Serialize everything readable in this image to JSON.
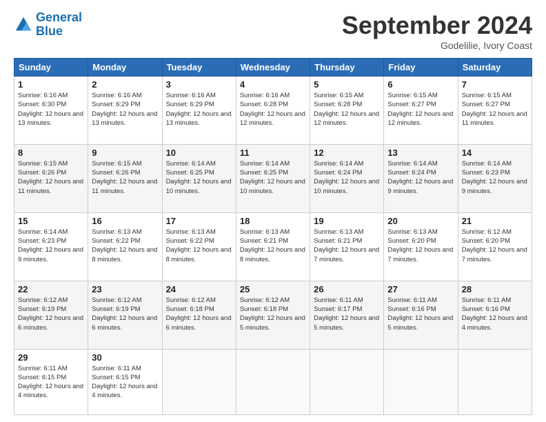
{
  "header": {
    "logo_text_general": "General",
    "logo_text_blue": "Blue",
    "month_title": "September 2024",
    "location": "Godelilie, Ivory Coast"
  },
  "days_of_week": [
    "Sunday",
    "Monday",
    "Tuesday",
    "Wednesday",
    "Thursday",
    "Friday",
    "Saturday"
  ],
  "weeks": [
    [
      {
        "day": "1",
        "sunrise": "Sunrise: 6:16 AM",
        "sunset": "Sunset: 6:30 PM",
        "daylight": "Daylight: 12 hours and 13 minutes."
      },
      {
        "day": "2",
        "sunrise": "Sunrise: 6:16 AM",
        "sunset": "Sunset: 6:29 PM",
        "daylight": "Daylight: 12 hours and 13 minutes."
      },
      {
        "day": "3",
        "sunrise": "Sunrise: 6:16 AM",
        "sunset": "Sunset: 6:29 PM",
        "daylight": "Daylight: 12 hours and 13 minutes."
      },
      {
        "day": "4",
        "sunrise": "Sunrise: 6:16 AM",
        "sunset": "Sunset: 6:28 PM",
        "daylight": "Daylight: 12 hours and 12 minutes."
      },
      {
        "day": "5",
        "sunrise": "Sunrise: 6:15 AM",
        "sunset": "Sunset: 6:28 PM",
        "daylight": "Daylight: 12 hours and 12 minutes."
      },
      {
        "day": "6",
        "sunrise": "Sunrise: 6:15 AM",
        "sunset": "Sunset: 6:27 PM",
        "daylight": "Daylight: 12 hours and 12 minutes."
      },
      {
        "day": "7",
        "sunrise": "Sunrise: 6:15 AM",
        "sunset": "Sunset: 6:27 PM",
        "daylight": "Daylight: 12 hours and 11 minutes."
      }
    ],
    [
      {
        "day": "8",
        "sunrise": "Sunrise: 6:15 AM",
        "sunset": "Sunset: 6:26 PM",
        "daylight": "Daylight: 12 hours and 11 minutes."
      },
      {
        "day": "9",
        "sunrise": "Sunrise: 6:15 AM",
        "sunset": "Sunset: 6:26 PM",
        "daylight": "Daylight: 12 hours and 11 minutes."
      },
      {
        "day": "10",
        "sunrise": "Sunrise: 6:14 AM",
        "sunset": "Sunset: 6:25 PM",
        "daylight": "Daylight: 12 hours and 10 minutes."
      },
      {
        "day": "11",
        "sunrise": "Sunrise: 6:14 AM",
        "sunset": "Sunset: 6:25 PM",
        "daylight": "Daylight: 12 hours and 10 minutes."
      },
      {
        "day": "12",
        "sunrise": "Sunrise: 6:14 AM",
        "sunset": "Sunset: 6:24 PM",
        "daylight": "Daylight: 12 hours and 10 minutes."
      },
      {
        "day": "13",
        "sunrise": "Sunrise: 6:14 AM",
        "sunset": "Sunset: 6:24 PM",
        "daylight": "Daylight: 12 hours and 9 minutes."
      },
      {
        "day": "14",
        "sunrise": "Sunrise: 6:14 AM",
        "sunset": "Sunset: 6:23 PM",
        "daylight": "Daylight: 12 hours and 9 minutes."
      }
    ],
    [
      {
        "day": "15",
        "sunrise": "Sunrise: 6:14 AM",
        "sunset": "Sunset: 6:23 PM",
        "daylight": "Daylight: 12 hours and 9 minutes."
      },
      {
        "day": "16",
        "sunrise": "Sunrise: 6:13 AM",
        "sunset": "Sunset: 6:22 PM",
        "daylight": "Daylight: 12 hours and 8 minutes."
      },
      {
        "day": "17",
        "sunrise": "Sunrise: 6:13 AM",
        "sunset": "Sunset: 6:22 PM",
        "daylight": "Daylight: 12 hours and 8 minutes."
      },
      {
        "day": "18",
        "sunrise": "Sunrise: 6:13 AM",
        "sunset": "Sunset: 6:21 PM",
        "daylight": "Daylight: 12 hours and 8 minutes."
      },
      {
        "day": "19",
        "sunrise": "Sunrise: 6:13 AM",
        "sunset": "Sunset: 6:21 PM",
        "daylight": "Daylight: 12 hours and 7 minutes."
      },
      {
        "day": "20",
        "sunrise": "Sunrise: 6:13 AM",
        "sunset": "Sunset: 6:20 PM",
        "daylight": "Daylight: 12 hours and 7 minutes."
      },
      {
        "day": "21",
        "sunrise": "Sunrise: 6:12 AM",
        "sunset": "Sunset: 6:20 PM",
        "daylight": "Daylight: 12 hours and 7 minutes."
      }
    ],
    [
      {
        "day": "22",
        "sunrise": "Sunrise: 6:12 AM",
        "sunset": "Sunset: 6:19 PM",
        "daylight": "Daylight: 12 hours and 6 minutes."
      },
      {
        "day": "23",
        "sunrise": "Sunrise: 6:12 AM",
        "sunset": "Sunset: 6:19 PM",
        "daylight": "Daylight: 12 hours and 6 minutes."
      },
      {
        "day": "24",
        "sunrise": "Sunrise: 6:12 AM",
        "sunset": "Sunset: 6:18 PM",
        "daylight": "Daylight: 12 hours and 6 minutes."
      },
      {
        "day": "25",
        "sunrise": "Sunrise: 6:12 AM",
        "sunset": "Sunset: 6:18 PM",
        "daylight": "Daylight: 12 hours and 5 minutes."
      },
      {
        "day": "26",
        "sunrise": "Sunrise: 6:11 AM",
        "sunset": "Sunset: 6:17 PM",
        "daylight": "Daylight: 12 hours and 5 minutes."
      },
      {
        "day": "27",
        "sunrise": "Sunrise: 6:11 AM",
        "sunset": "Sunset: 6:16 PM",
        "daylight": "Daylight: 12 hours and 5 minutes."
      },
      {
        "day": "28",
        "sunrise": "Sunrise: 6:11 AM",
        "sunset": "Sunset: 6:16 PM",
        "daylight": "Daylight: 12 hours and 4 minutes."
      }
    ],
    [
      {
        "day": "29",
        "sunrise": "Sunrise: 6:11 AM",
        "sunset": "Sunset: 6:15 PM",
        "daylight": "Daylight: 12 hours and 4 minutes."
      },
      {
        "day": "30",
        "sunrise": "Sunrise: 6:11 AM",
        "sunset": "Sunset: 6:15 PM",
        "daylight": "Daylight: 12 hours and 4 minutes."
      },
      {
        "day": "",
        "sunrise": "",
        "sunset": "",
        "daylight": ""
      },
      {
        "day": "",
        "sunrise": "",
        "sunset": "",
        "daylight": ""
      },
      {
        "day": "",
        "sunrise": "",
        "sunset": "",
        "daylight": ""
      },
      {
        "day": "",
        "sunrise": "",
        "sunset": "",
        "daylight": ""
      },
      {
        "day": "",
        "sunrise": "",
        "sunset": "",
        "daylight": ""
      }
    ]
  ]
}
